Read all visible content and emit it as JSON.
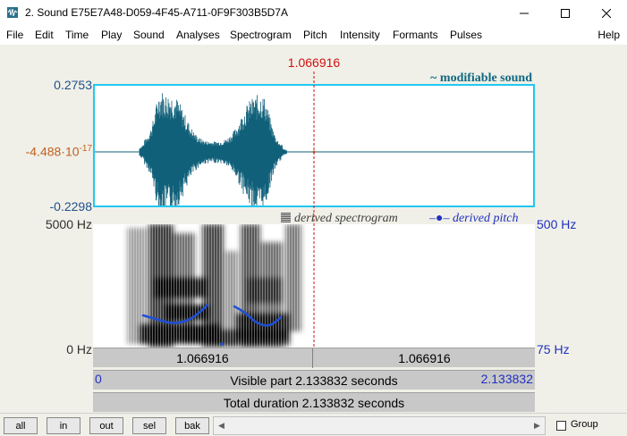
{
  "window": {
    "title": "2. Sound E75E7A48-D059-4F45-A711-0F9F303B5D7A"
  },
  "menu": {
    "items": [
      "File",
      "Edit",
      "Time",
      "Play",
      "Sound",
      "Analyses",
      "Spectrogram",
      "Pitch",
      "Intensity",
      "Formants",
      "Pulses"
    ],
    "help": "Help"
  },
  "cursor": {
    "time_label": "1.066916"
  },
  "waveform": {
    "label": "~ modifiable sound",
    "y_max": "0.2753",
    "y_mid_base": "-4.488·10",
    "y_mid_exp": "-17",
    "y_min": "-0.2298"
  },
  "spectrogram": {
    "legend_spectrogram": "derived spectrogram",
    "legend_pitch": "derived pitch",
    "freq_top": "5000 Hz",
    "freq_bottom": "0 Hz",
    "pitch_top": "500 Hz",
    "pitch_bottom": "75 Hz"
  },
  "bars": {
    "left_part": "1.066916",
    "right_part": "1.066916",
    "visible_start": "0",
    "visible_label": "Visible part 2.133832 seconds",
    "visible_end": "2.133832",
    "total_label": "Total duration 2.133832 seconds"
  },
  "toolbar": {
    "buttons": [
      "all",
      "in",
      "out",
      "sel",
      "bak"
    ],
    "group_label": "Group"
  },
  "colors": {
    "wave": "#10607a",
    "cursor": "#d01010",
    "pitch": "#1e4fd8",
    "frame": "#20c8f0"
  }
}
